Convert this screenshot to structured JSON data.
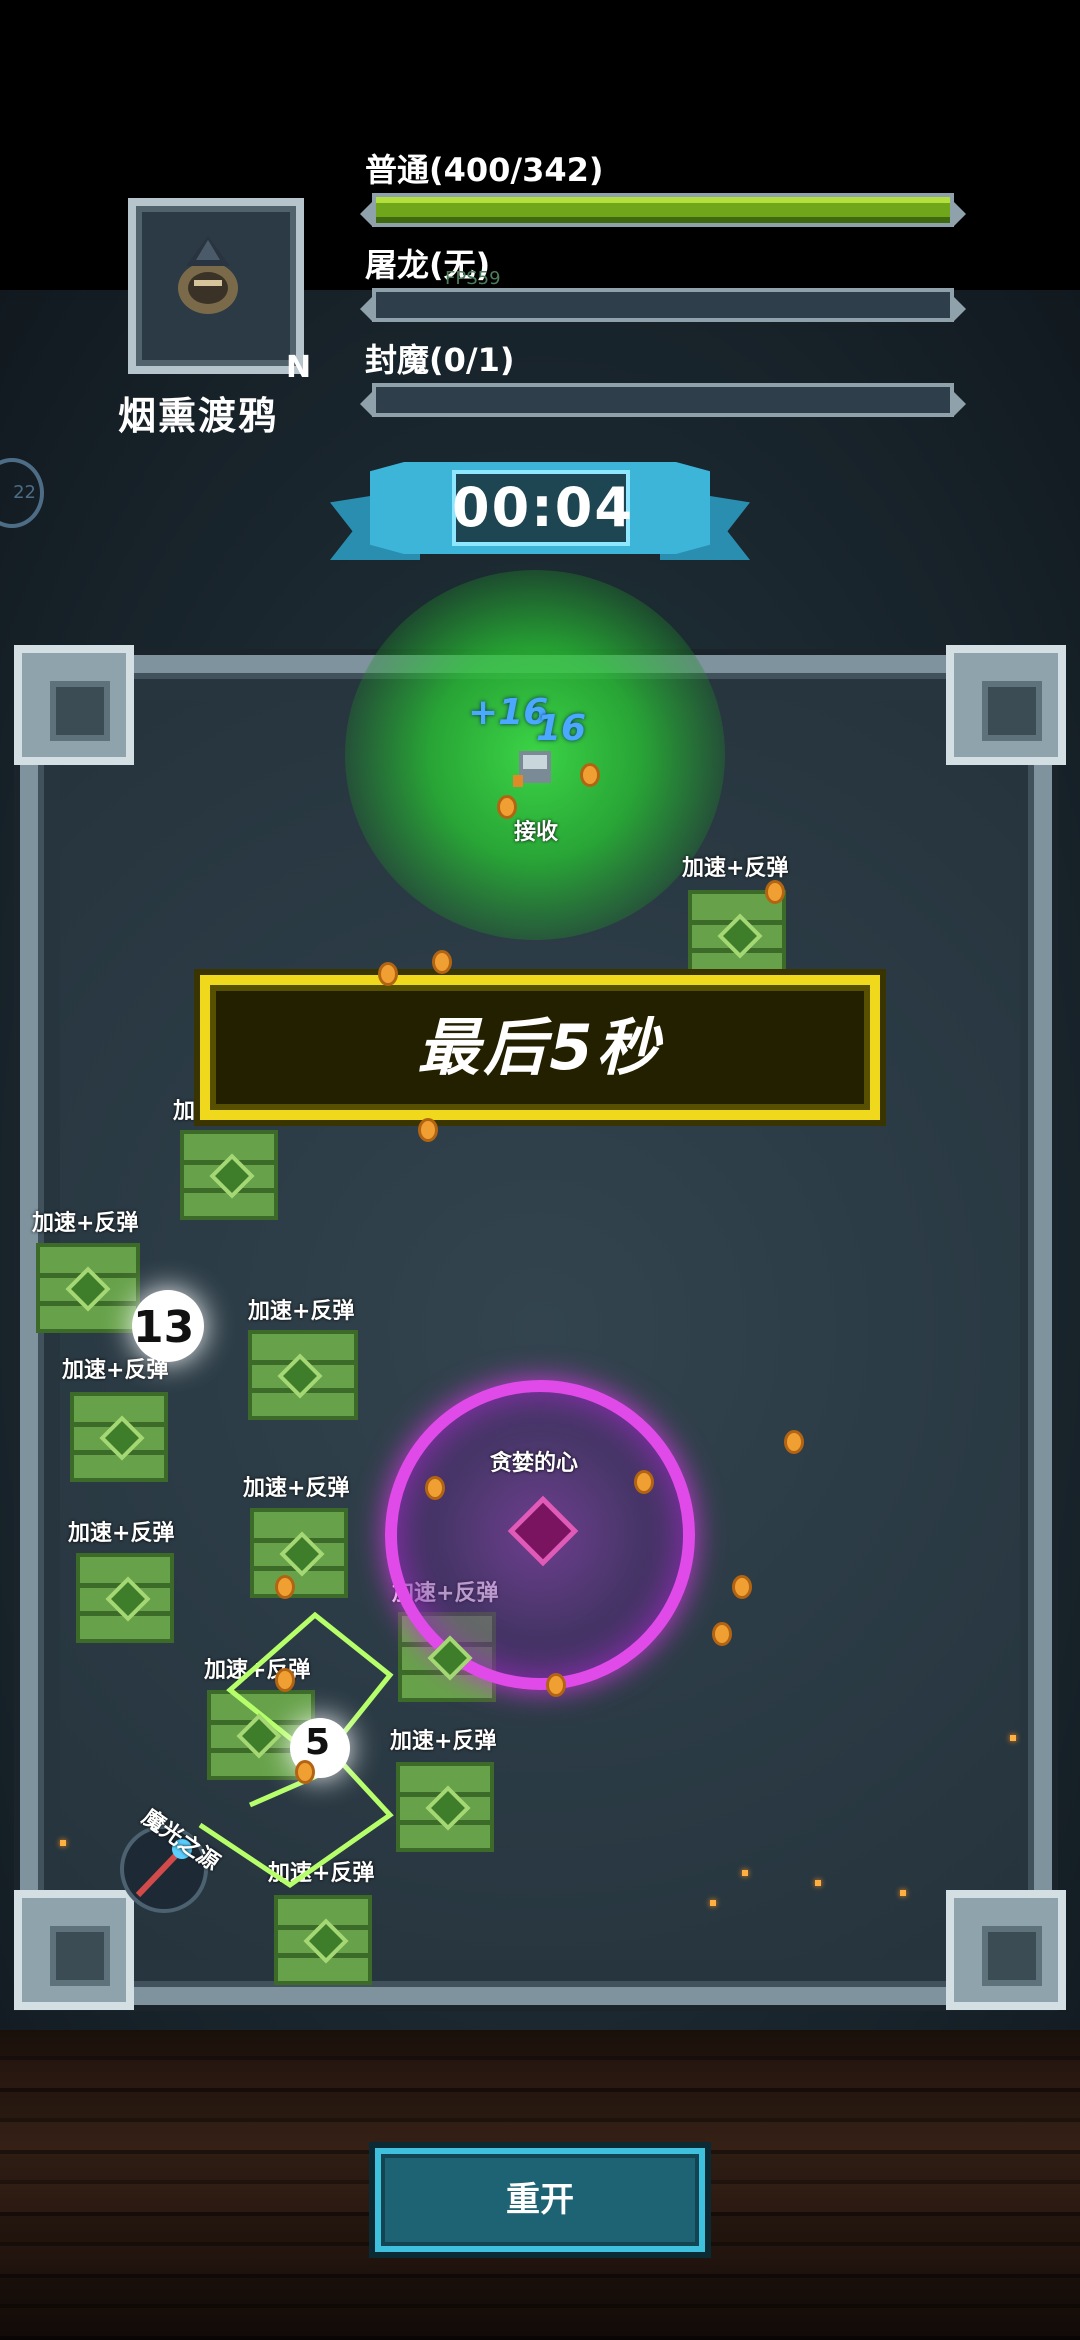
{
  "character": {
    "name": "烟熏渡鸦",
    "rank": "N",
    "icon": "raven-icon"
  },
  "bars": [
    {
      "label": "普通(400/342)",
      "progress": 1.0
    },
    {
      "label": "屠龙(无)",
      "progress": 0
    },
    {
      "label": "封魔(0/1)",
      "progress": 0
    }
  ],
  "debug": {
    "fps": "FPS59"
  },
  "side_badge": "22",
  "timer": "00:04",
  "banner": "最后5秒",
  "battle": {
    "float_numbers": [
      "+16",
      "16"
    ],
    "receiver_label": "接收",
    "boss_label": "贪婪的心",
    "wand_label": "魔光之源",
    "partial_label": "加速",
    "block_label": "加速+反弹",
    "ball_numbers": [
      "13",
      "5"
    ]
  },
  "restart_button": "重开",
  "colors": {
    "bar_fill": "#6fa61a",
    "banner": "#f0d81c",
    "orb": "#e04ae8",
    "burst": "#3cdc46",
    "button": "#1d6373"
  }
}
